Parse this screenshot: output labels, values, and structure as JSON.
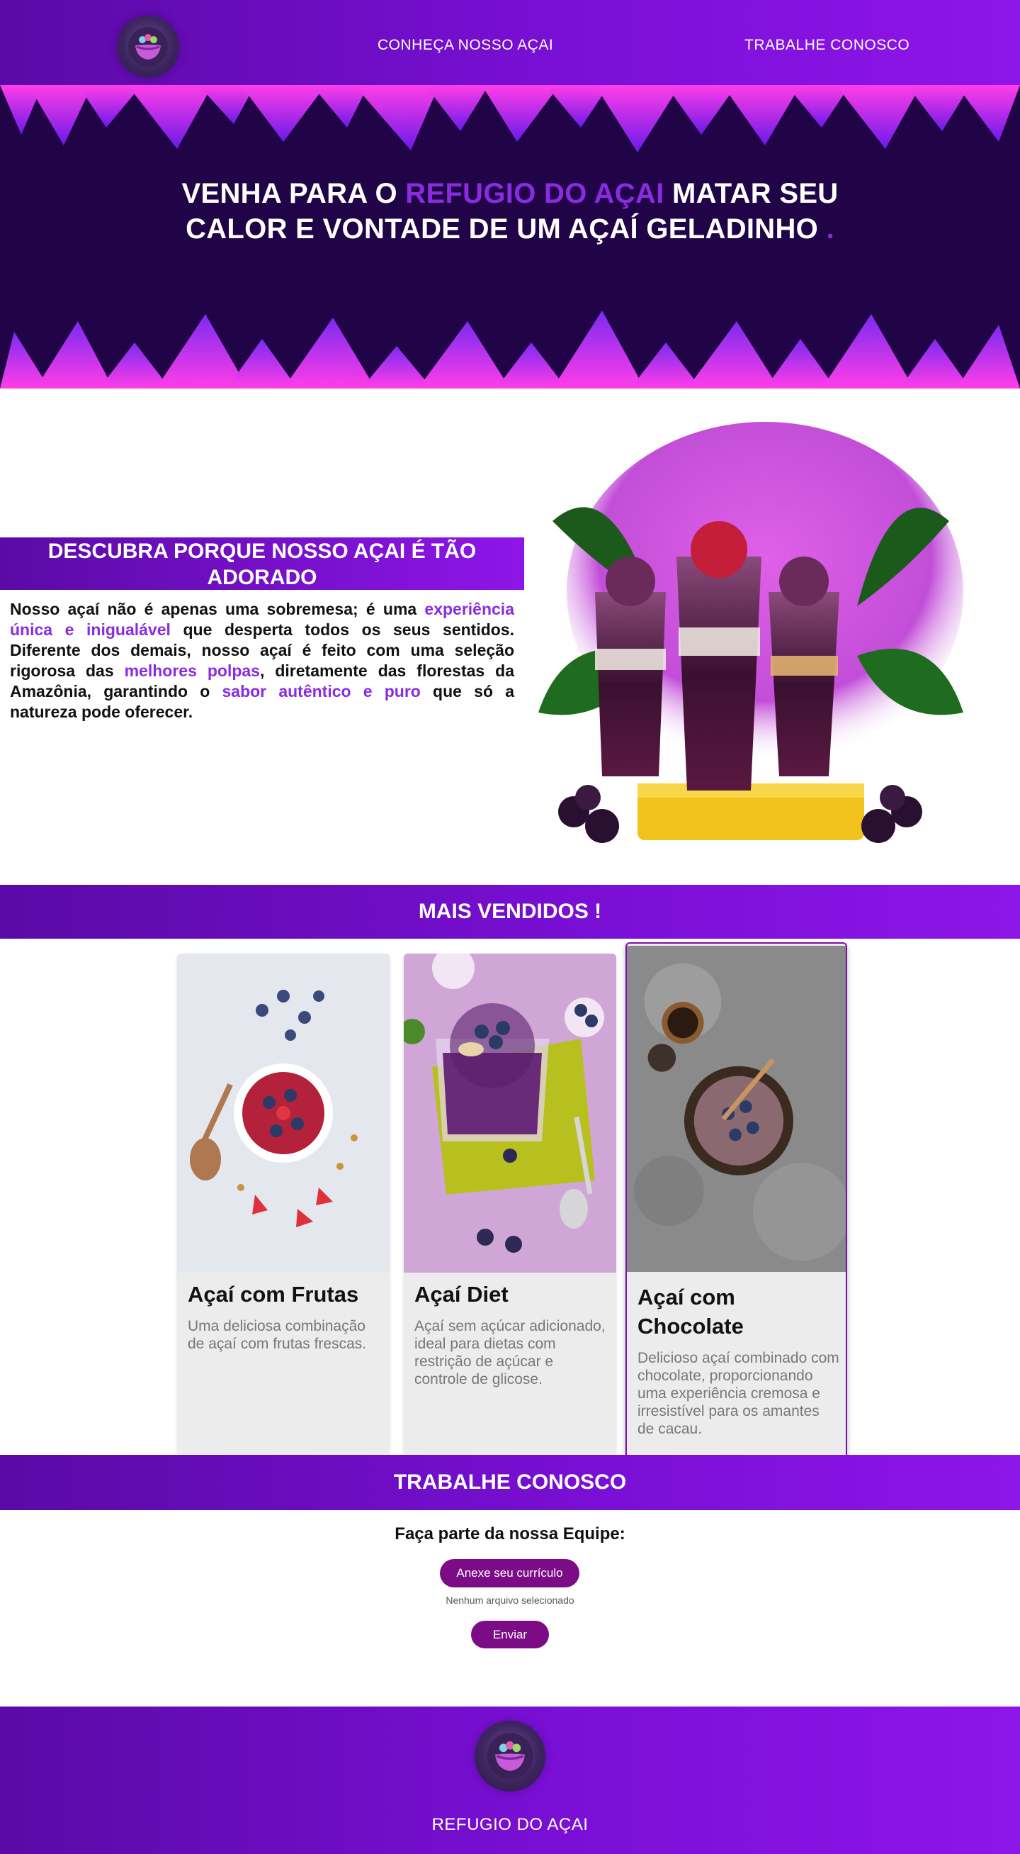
{
  "nav": {
    "links": [
      "CONHEÇA NOSSO AÇAI",
      "TRABALHE CONOSCO"
    ]
  },
  "hero": {
    "title_part1": "VENHA PARA O ",
    "title_highlight": "REFUGIO DO AÇAI",
    "title_part2": " MATAR SEU CALOR E VONTADE DE UM AÇAÍ GELADINHO ",
    "title_dot": "."
  },
  "about": {
    "heading": "DESCUBRA PORQUE NOSSO AÇAI É TÃO ADORADO",
    "t1": "Nosso açaí não é apenas uma sobremesa; é uma ",
    "h1": "experiência única e inigualável",
    "t2": " que desperta todos os seus sentidos. Diferente dos demais, nosso açaí é feito com uma seleção rigorosa das ",
    "h2": "melhores polpas",
    "t3": ", diretamente das florestas da Amazônia, garantindo o ",
    "h3": "sabor autêntico e puro",
    "t4": " que só a natureza pode oferecer."
  },
  "best_sellers": {
    "title": "MAIS VENDIDOS !",
    "items": [
      {
        "name": "Açaí com Frutas",
        "desc": "Uma deliciosa combinação de açaí com frutas frescas."
      },
      {
        "name": "Açaí Diet",
        "desc": "Açaí sem açúcar adicionado, ideal para dietas com restrição de açúcar e controle de glicose."
      },
      {
        "name": "Açaí com Chocolate",
        "desc": "Delicioso açaí combinado com chocolate, proporcionando uma experiência cremosa e irresistível para os amantes de cacau."
      }
    ]
  },
  "careers": {
    "title": "TRABALHE CONOSCO",
    "subtitle": "Faça parte da nossa Equipe:",
    "upload_label": "Anexe seu currículo",
    "no_file": "Nenhum arquivo selecionado",
    "submit_label": "Enviar"
  },
  "footer": {
    "brand": "REFUGIO DO AÇAI"
  },
  "colors": {
    "brand_purple": "#7a0fd6",
    "accent_purple": "#8a2be2",
    "hero_bg": "#200447",
    "button": "#7b0c86"
  },
  "icons": [
    "logo-acai-bowl-icon"
  ]
}
